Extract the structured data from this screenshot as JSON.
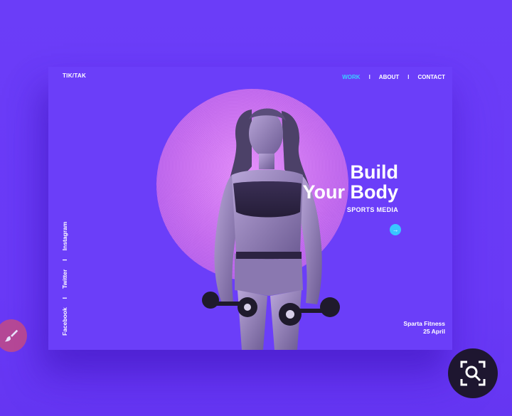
{
  "header": {
    "brand": "TIK/TAK",
    "nav": [
      {
        "label": "WORK",
        "active": true
      },
      {
        "label": "ABOUT",
        "active": false
      },
      {
        "label": "CONTACT",
        "active": false
      }
    ],
    "separator": "I"
  },
  "hero": {
    "line1": "Build",
    "line2": "Your Body",
    "subtitle": "SPORTS MEDIA",
    "next_icon": "arrow-right-icon"
  },
  "social": [
    "Facebook",
    "Twitter",
    "Instagram"
  ],
  "footer_meta": {
    "name": "Sparta Fitness",
    "date": "25 April"
  },
  "overlay": {
    "left_icon": "paintbrush-icon",
    "right_icon": "visual-search-icon"
  },
  "colors": {
    "background": "#6b3ef9",
    "accent": "#39c5ff",
    "circle": "#c76af2"
  }
}
